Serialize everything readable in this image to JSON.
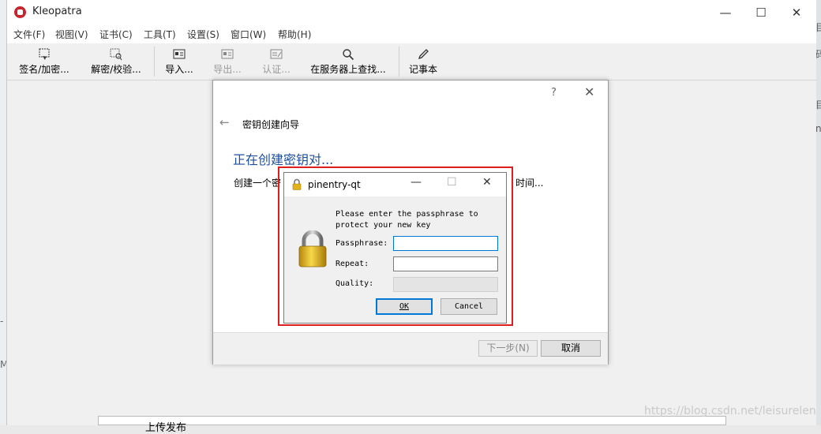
{
  "app": {
    "title": "Kleopatra"
  },
  "window_controls": {
    "minimize": "—",
    "maximize": "☐",
    "close": "✕"
  },
  "menu": [
    "文件(F)",
    "视图(V)",
    "证书(C)",
    "工具(T)",
    "设置(S)",
    "窗口(W)",
    "帮助(H)"
  ],
  "toolbar": [
    {
      "label": "签名/加密...",
      "icon": "sign-encrypt-icon",
      "enabled": true
    },
    {
      "label": "解密/校验...",
      "icon": "decrypt-verify-icon",
      "enabled": true
    },
    {
      "label": "导入...",
      "icon": "import-icon",
      "enabled": true
    },
    {
      "label": "导出...",
      "icon": "export-icon",
      "enabled": false
    },
    {
      "label": "认证...",
      "icon": "certify-icon",
      "enabled": false
    },
    {
      "label": "在服务器上查找...",
      "icon": "search-icon",
      "enabled": true
    },
    {
      "label": "记事本",
      "icon": "notepad-pen-icon",
      "enabled": true
    }
  ],
  "background": {
    "bottom_text": "上传发布"
  },
  "watermark": "https://blog.csdn.net/leisurelen",
  "wizard": {
    "help": "?",
    "close": "✕",
    "back": "←",
    "title": "密钥创建向导",
    "heading": "正在创建密钥对...",
    "desc_left": "创建一个密",
    "desc_right": "时间...",
    "next_button": "下一步(N)",
    "cancel_button": "取消"
  },
  "pinentry": {
    "title": "pinentry-qt",
    "minimize": "—",
    "maximize": "☐",
    "close": "✕",
    "message_line1": "Please enter the passphrase to",
    "message_line2": "protect your new key",
    "passphrase_label": "Passphrase:",
    "passphrase_value": "",
    "repeat_label": "Repeat:",
    "repeat_value": "",
    "quality_label": "Quality:",
    "ok_button": "OK",
    "cancel_button": "Cancel"
  },
  "colors": {
    "highlight_frame": "#e01e1e",
    "focus": "#0078d7",
    "wizard_heading": "#1d4fa0"
  }
}
